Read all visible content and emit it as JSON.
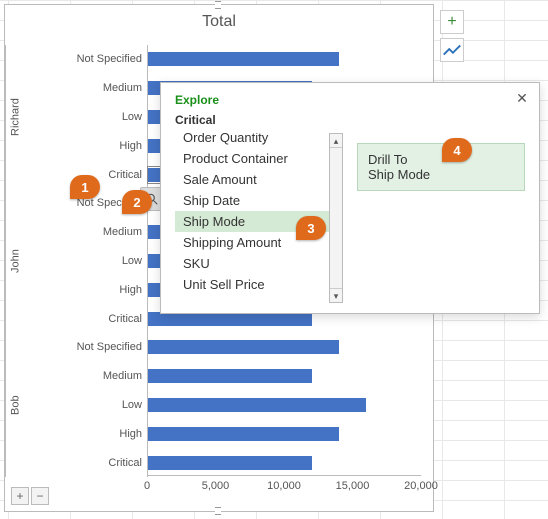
{
  "chart_data": {
    "type": "bar",
    "title": "Total",
    "xlabel": "",
    "ylabel": "",
    "xlim": [
      0,
      20000
    ],
    "xticks": [
      0,
      5000,
      10000,
      15000,
      20000
    ],
    "xtick_labels": [
      "0",
      "5,000",
      "10,000",
      "15,000",
      "20,000"
    ],
    "groups": [
      {
        "name": "Richard",
        "items": [
          {
            "category": "Not Specified",
            "value": 14000
          },
          {
            "category": "Medium",
            "value": 12000
          },
          {
            "category": "Low",
            "value": 16000
          },
          {
            "category": "High",
            "value": 14000
          },
          {
            "category": "Critical",
            "value": 12000
          }
        ]
      },
      {
        "name": "John",
        "items": [
          {
            "category": "Not Specified",
            "value": 14000
          },
          {
            "category": "Medium",
            "value": 12000
          },
          {
            "category": "Low",
            "value": 16000
          },
          {
            "category": "High",
            "value": 14000
          },
          {
            "category": "Critical",
            "value": 12000
          }
        ]
      },
      {
        "name": "Bob",
        "items": [
          {
            "category": "Not Specified",
            "value": 14000
          },
          {
            "category": "Medium",
            "value": 12000
          },
          {
            "category": "Low",
            "value": 16000
          },
          {
            "category": "High",
            "value": 14000
          },
          {
            "category": "Critical",
            "value": 12000
          }
        ]
      }
    ]
  },
  "chart": {
    "plus_label": "+",
    "brush_label": "✎",
    "zoom_in": "+",
    "zoom_out": "−",
    "selected_bar": {
      "group": 0,
      "index": 4
    }
  },
  "popup": {
    "title": "Explore",
    "context": "Critical",
    "list": [
      "Order Quantity",
      "Product Container",
      "Sale Amount",
      "Ship Date",
      "Ship Mode",
      "Shipping Amount",
      "SKU",
      "Unit Sell Price"
    ],
    "selected_index": 4,
    "drill_line1": "Drill To",
    "drill_line2": "Ship Mode"
  },
  "callouts": {
    "c1": "1",
    "c2": "2",
    "c3": "3",
    "c4": "4"
  }
}
